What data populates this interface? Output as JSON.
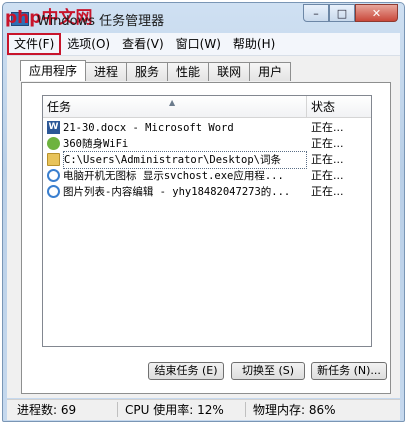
{
  "watermark": "php中文网",
  "window": {
    "title": "Windows 任务管理器"
  },
  "caption": {
    "minimize": "–",
    "maximize": "□",
    "close": "✕"
  },
  "menu": [
    {
      "label": "文件(F)"
    },
    {
      "label": "选项(O)"
    },
    {
      "label": "查看(V)"
    },
    {
      "label": "窗口(W)"
    },
    {
      "label": "帮助(H)"
    }
  ],
  "tabs": [
    {
      "label": "应用程序"
    },
    {
      "label": "进程"
    },
    {
      "label": "服务"
    },
    {
      "label": "性能"
    },
    {
      "label": "联网"
    },
    {
      "label": "用户"
    }
  ],
  "list": {
    "columns": {
      "task": "任务",
      "status": "状态"
    },
    "sort_indicator": "▲",
    "rows": [
      {
        "icon": "word-icon",
        "name": "21-30.docx - Microsoft Word",
        "status": "正在..."
      },
      {
        "icon": "wifi-icon",
        "name": "360随身WiFi",
        "status": "正在..."
      },
      {
        "icon": "folder-icon",
        "name": "C:\\Users\\Administrator\\Desktop\\词条",
        "status": "正在..."
      },
      {
        "icon": "ie-icon",
        "name": "电脑开机无图标 显示svchost.exe应用程...",
        "status": "正在..."
      },
      {
        "icon": "ie-icon",
        "name": "图片列表-内容编辑 - yhy18482047273的...",
        "status": "正在..."
      }
    ]
  },
  "actions": {
    "end_task": "结束任务 (E)",
    "switch_to": "切换至 (S)",
    "new_task": "新任务 (N)..."
  },
  "statusbar": {
    "processes": "进程数: 69",
    "cpu": "CPU 使用率: 12%",
    "memory": "物理内存: 86%"
  },
  "icon_glyphs": {
    "word": "W"
  }
}
